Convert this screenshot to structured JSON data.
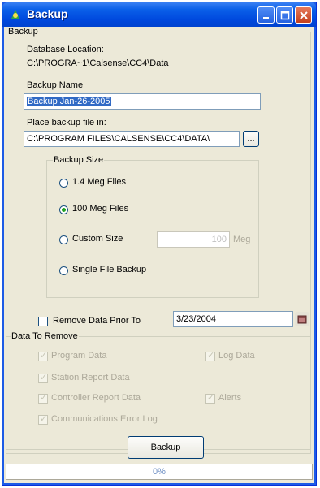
{
  "window": {
    "title": "Backup"
  },
  "main": {
    "group_label": "Backup",
    "db_location_label": "Database Location:",
    "db_location_value": "C:\\PROGRA~1\\Calsense\\CC4\\Data",
    "backup_name_label": "Backup Name",
    "backup_name_value": "Backup Jan-26-2005",
    "place_in_label": "Place backup file in:",
    "place_in_value": "C:\\PROGRAM FILES\\CALSENSE\\CC4\\DATA\\",
    "browse_label": "..."
  },
  "backup_size": {
    "group_label": "Backup Size",
    "options": [
      {
        "label": "1.4 Meg Files",
        "checked": false
      },
      {
        "label": "100 Meg Files",
        "checked": true
      },
      {
        "label": "Custom Size",
        "checked": false
      },
      {
        "label": "Single File Backup",
        "checked": false
      }
    ],
    "custom_value": "100",
    "custom_unit": "Meg"
  },
  "remove": {
    "checkbox_label": "Remove Data Prior To",
    "date_value": "3/23/2004"
  },
  "data_to_remove": {
    "group_label": "Data To Remove",
    "items": [
      {
        "label": "Program Data",
        "checked": true
      },
      {
        "label": "Log Data",
        "checked": true
      },
      {
        "label": "Station Report Data",
        "checked": true
      },
      {
        "label": "Controller Report Data",
        "checked": true
      },
      {
        "label": "Alerts",
        "checked": true
      },
      {
        "label": "Communications Error Log",
        "checked": true
      }
    ]
  },
  "actions": {
    "backup_button": "Backup"
  },
  "status": {
    "text": "0%"
  },
  "colors": {
    "titlebar": "#0054e3",
    "window_bg": "#ece9d8",
    "selection": "#316ac5",
    "check_green": "#21a121"
  }
}
